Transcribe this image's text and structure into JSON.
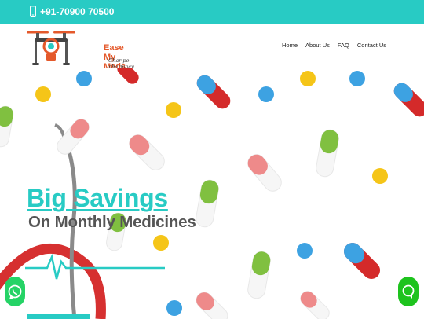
{
  "topbar": {
    "phone": "+91-70900 70500",
    "icon": "mobile-phone-icon"
  },
  "logo": {
    "brand": "Ease My Meds",
    "tagline": "Ghar pe pharmacy",
    "icon": "drone-logo-icon"
  },
  "nav": {
    "items": [
      "Home",
      "About Us",
      "FAQ",
      "Contact Us"
    ]
  },
  "hero": {
    "headline": "Big Savings",
    "subheadline": "On Monthly Medicines"
  },
  "colors": {
    "accent": "#28cbc4",
    "brand": "#e4592b",
    "heading_gray": "#555555",
    "whatsapp": "#25d366"
  },
  "floating": {
    "left_icon": "whatsapp-icon",
    "right_icon": "chat-icon"
  }
}
